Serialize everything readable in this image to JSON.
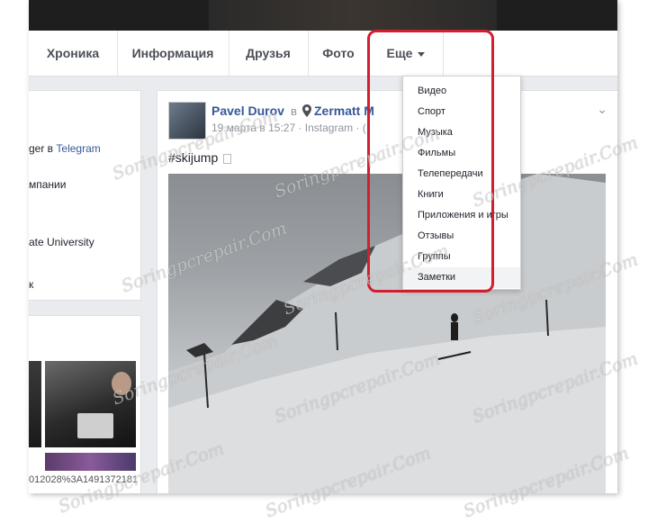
{
  "nav": {
    "tabs": [
      {
        "label": "Хроника"
      },
      {
        "label": "Информация"
      },
      {
        "label": "Друзья"
      },
      {
        "label": "Фото"
      },
      {
        "label": "Еще"
      }
    ]
  },
  "left_intro": {
    "line1_pre": "ger в ",
    "line1_link": "Telegram",
    "line2": "мпании",
    "line3": "ate University",
    "line4": "к"
  },
  "left_photos": {
    "url_fragment": "012028%3A1491372181"
  },
  "post": {
    "author": "Pavel Durov",
    "in_word": "в",
    "place": "Zermatt M",
    "meta": "19 марта в 15:27 · Instagram · (",
    "hashtag": "#skijump"
  },
  "dropdown": {
    "items": [
      {
        "label": "Видео"
      },
      {
        "label": "Спорт"
      },
      {
        "label": "Музыка"
      },
      {
        "label": "Фильмы"
      },
      {
        "label": "Телепередачи"
      },
      {
        "label": "Книги"
      },
      {
        "label": "Приложения и игры"
      },
      {
        "label": "Отзывы"
      },
      {
        "label": "Группы"
      },
      {
        "label": "Заметки"
      }
    ]
  },
  "watermark": "Soringpcrepair.Com",
  "colors": {
    "link": "#365899",
    "highlight_ring": "#d11f2f"
  }
}
